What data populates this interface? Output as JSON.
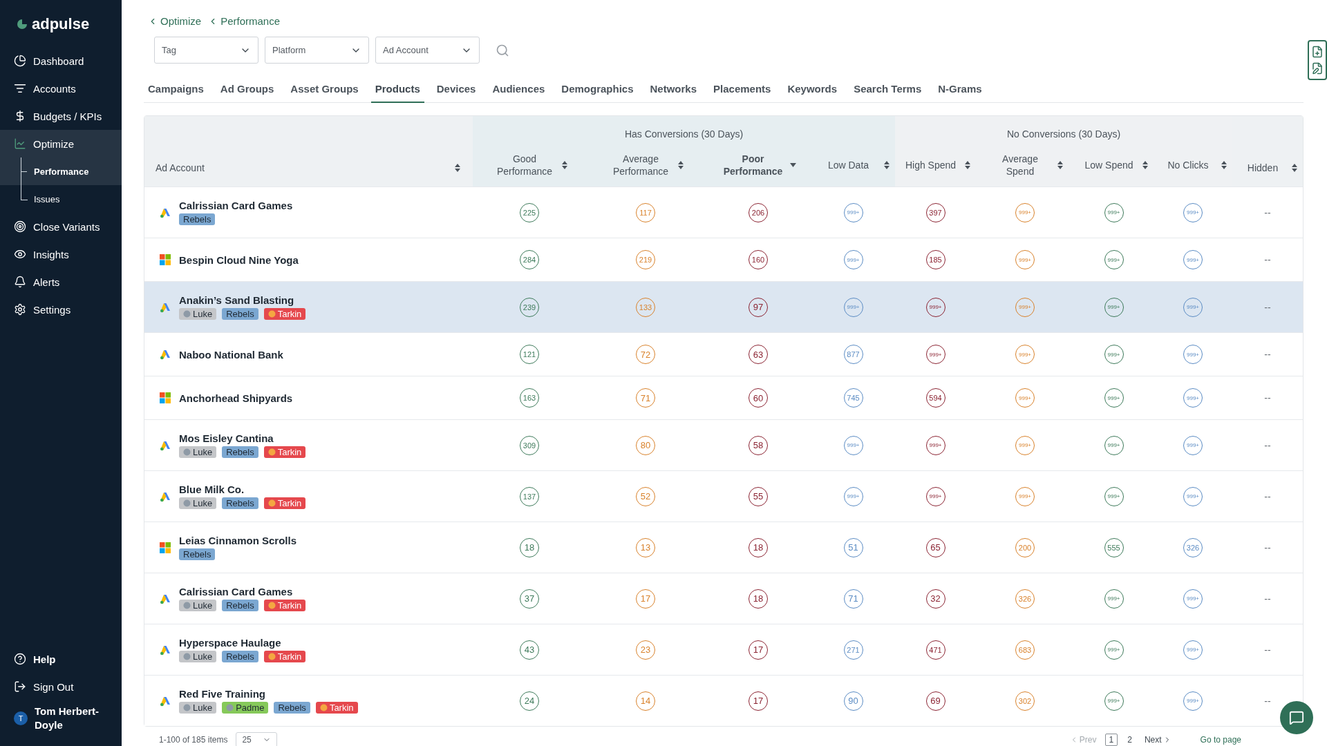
{
  "sidebar": {
    "logo": "adpulse",
    "items": [
      {
        "label": "Dashboard",
        "selected": false
      },
      {
        "label": "Accounts",
        "selected": false
      },
      {
        "label": "Budgets / KPIs",
        "selected": false
      },
      {
        "label": "Optimize",
        "selected": true,
        "expanded": true,
        "children": [
          {
            "label": "Performance",
            "selected": true
          },
          {
            "label": "Issues",
            "selected": false
          }
        ]
      },
      {
        "label": "Close Variants",
        "selected": false
      },
      {
        "label": "Insights",
        "selected": false
      },
      {
        "label": "Alerts",
        "selected": false
      },
      {
        "label": "Settings",
        "selected": false
      }
    ],
    "bottom_items": [
      {
        "label": "Help"
      },
      {
        "label": "Sign Out"
      }
    ],
    "user": {
      "initial": "T",
      "name": "Tom Herbert-Doyle"
    }
  },
  "breadcrumb": [
    "Optimize",
    "Performance"
  ],
  "filters": [
    {
      "placeholder": "Tag"
    },
    {
      "placeholder": "Platform"
    },
    {
      "placeholder": "Ad Account"
    }
  ],
  "tabs": [
    {
      "label": "Campaigns",
      "selected": false
    },
    {
      "label": "Ad Groups",
      "selected": false
    },
    {
      "label": "Asset Groups",
      "selected": false
    },
    {
      "label": "Products",
      "selected": true
    },
    {
      "label": "Devices",
      "selected": false
    },
    {
      "label": "Audiences",
      "selected": false
    },
    {
      "label": "Demographics",
      "selected": false
    },
    {
      "label": "Networks",
      "selected": false
    },
    {
      "label": "Placements",
      "selected": false
    },
    {
      "label": "Keywords",
      "selected": false
    },
    {
      "label": "Search Terms",
      "selected": false
    },
    {
      "label": "N-Grams",
      "selected": false
    }
  ],
  "table": {
    "groups": [
      {
        "label": "Has Conversions (30 Days)"
      },
      {
        "label": "No Conversions (30 Days)"
      }
    ],
    "first_column": {
      "label": "Ad Account",
      "sorted": false
    },
    "columns": [
      {
        "label": "Good Performance",
        "kind": "good",
        "sorted": false
      },
      {
        "label": "Average Performance",
        "kind": "average",
        "sorted": false
      },
      {
        "label": "Poor Performance",
        "kind": "poor",
        "sorted": true
      },
      {
        "label": "Low Data",
        "kind": "info",
        "sorted": false
      },
      {
        "label": "High Spend",
        "kind": "poor",
        "sorted": false
      },
      {
        "label": "Average Spend",
        "kind": "average",
        "sorted": false
      },
      {
        "label": "Low Spend",
        "kind": "good",
        "sorted": false
      },
      {
        "label": "No Clicks",
        "kind": "info",
        "sorted": false
      },
      {
        "label": "Hidden",
        "kind": "plain",
        "sorted": false
      }
    ],
    "rows": [
      {
        "name": "Calrissian Card Games",
        "kind": "triangle",
        "selected": false,
        "tags": [
          {
            "label": "Rebels",
            "color": "#7ba7d1",
            "icon": false
          }
        ],
        "cells": [
          "225",
          "117",
          "206",
          "999+",
          "397",
          "999+",
          "999+",
          "999+",
          "--"
        ]
      },
      {
        "name": "Bespin Cloud Nine Yoga",
        "kind": "squares",
        "selected": false,
        "tags": [],
        "cells": [
          "284",
          "219",
          "160",
          "999+",
          "185",
          "999+",
          "999+",
          "999+",
          "--"
        ]
      },
      {
        "name": "Anakin’s Sand Blasting",
        "kind": "triangle",
        "selected": true,
        "tags": [
          {
            "label": "Luke",
            "color": "#c4c6c9",
            "icon": true
          },
          {
            "label": "Rebels",
            "color": "#7ba7d1",
            "icon": false
          },
          {
            "label": "Tarkin",
            "color": "#e5484d",
            "icon": true
          }
        ],
        "cells": [
          "239",
          "133",
          "97",
          "999+",
          "999+",
          "999+",
          "999+",
          "999+",
          "--"
        ]
      },
      {
        "name": "Naboo National Bank",
        "kind": "triangle",
        "selected": false,
        "tags": [],
        "cells": [
          "121",
          "72",
          "63",
          "877",
          "999+",
          "999+",
          "999+",
          "999+",
          "--"
        ]
      },
      {
        "name": "Anchorhead Shipyards",
        "kind": "squares",
        "selected": false,
        "tags": [],
        "cells": [
          "163",
          "71",
          "60",
          "745",
          "594",
          "999+",
          "999+",
          "999+",
          "--"
        ]
      },
      {
        "name": "Mos Eisley Cantina",
        "kind": "triangle",
        "selected": false,
        "tags": [
          {
            "label": "Luke",
            "color": "#c4c6c9",
            "icon": true
          },
          {
            "label": "Rebels",
            "color": "#7ba7d1",
            "icon": false
          },
          {
            "label": "Tarkin",
            "color": "#e5484d",
            "icon": true
          }
        ],
        "cells": [
          "309",
          "80",
          "58",
          "999+",
          "999+",
          "999+",
          "999+",
          "999+",
          "--"
        ]
      },
      {
        "name": "Blue Milk Co.",
        "kind": "triangle",
        "selected": false,
        "tags": [
          {
            "label": "Luke",
            "color": "#c4c6c9",
            "icon": true
          },
          {
            "label": "Rebels",
            "color": "#7ba7d1",
            "icon": false
          },
          {
            "label": "Tarkin",
            "color": "#e5484d",
            "icon": true
          }
        ],
        "cells": [
          "137",
          "52",
          "55",
          "999+",
          "999+",
          "999+",
          "999+",
          "999+",
          "--"
        ]
      },
      {
        "name": "Leias Cinnamon Scrolls",
        "kind": "squares",
        "selected": false,
        "tags": [
          {
            "label": "Rebels",
            "color": "#7ba7d1",
            "icon": false
          }
        ],
        "cells": [
          "18",
          "13",
          "18",
          "51",
          "65",
          "200",
          "555",
          "326",
          "--"
        ]
      },
      {
        "name": "Calrissian Card Games",
        "kind": "triangle",
        "selected": false,
        "tags": [
          {
            "label": "Luke",
            "color": "#c4c6c9",
            "icon": true
          },
          {
            "label": "Rebels",
            "color": "#7ba7d1",
            "icon": false
          },
          {
            "label": "Tarkin",
            "color": "#e5484d",
            "icon": true
          }
        ],
        "cells": [
          "37",
          "17",
          "18",
          "71",
          "32",
          "326",
          "999+",
          "999+",
          "--"
        ]
      },
      {
        "name": "Hyperspace Haulage",
        "kind": "triangle",
        "selected": false,
        "tags": [
          {
            "label": "Luke",
            "color": "#c4c6c9",
            "icon": true
          },
          {
            "label": "Rebels",
            "color": "#7ba7d1",
            "icon": false
          },
          {
            "label": "Tarkin",
            "color": "#e5484d",
            "icon": true
          }
        ],
        "cells": [
          "43",
          "23",
          "17",
          "271",
          "471",
          "683",
          "999+",
          "999+",
          "--"
        ]
      },
      {
        "name": "Red Five Training",
        "kind": "triangle",
        "selected": false,
        "tags": [
          {
            "label": "Luke",
            "color": "#c4c6c9",
            "icon": true
          },
          {
            "label": "Padme",
            "color": "#86c95a",
            "icon": true
          },
          {
            "label": "Rebels",
            "color": "#7ba7d1",
            "icon": false
          },
          {
            "label": "Tarkin",
            "color": "#e5484d",
            "icon": true
          }
        ],
        "cells": [
          "24",
          "14",
          "17",
          "90",
          "69",
          "302",
          "999+",
          "999+",
          "--"
        ]
      }
    ]
  },
  "pagination": {
    "summary": "1-100 of 185 items",
    "page_size": "25",
    "prev": {
      "label": "Prev",
      "disabled": true
    },
    "pages": [
      {
        "label": "1",
        "selected": true
      },
      {
        "label": "2",
        "selected": false
      }
    ],
    "next": {
      "label": "Next",
      "disabled": false
    },
    "goto": "Go to page"
  }
}
